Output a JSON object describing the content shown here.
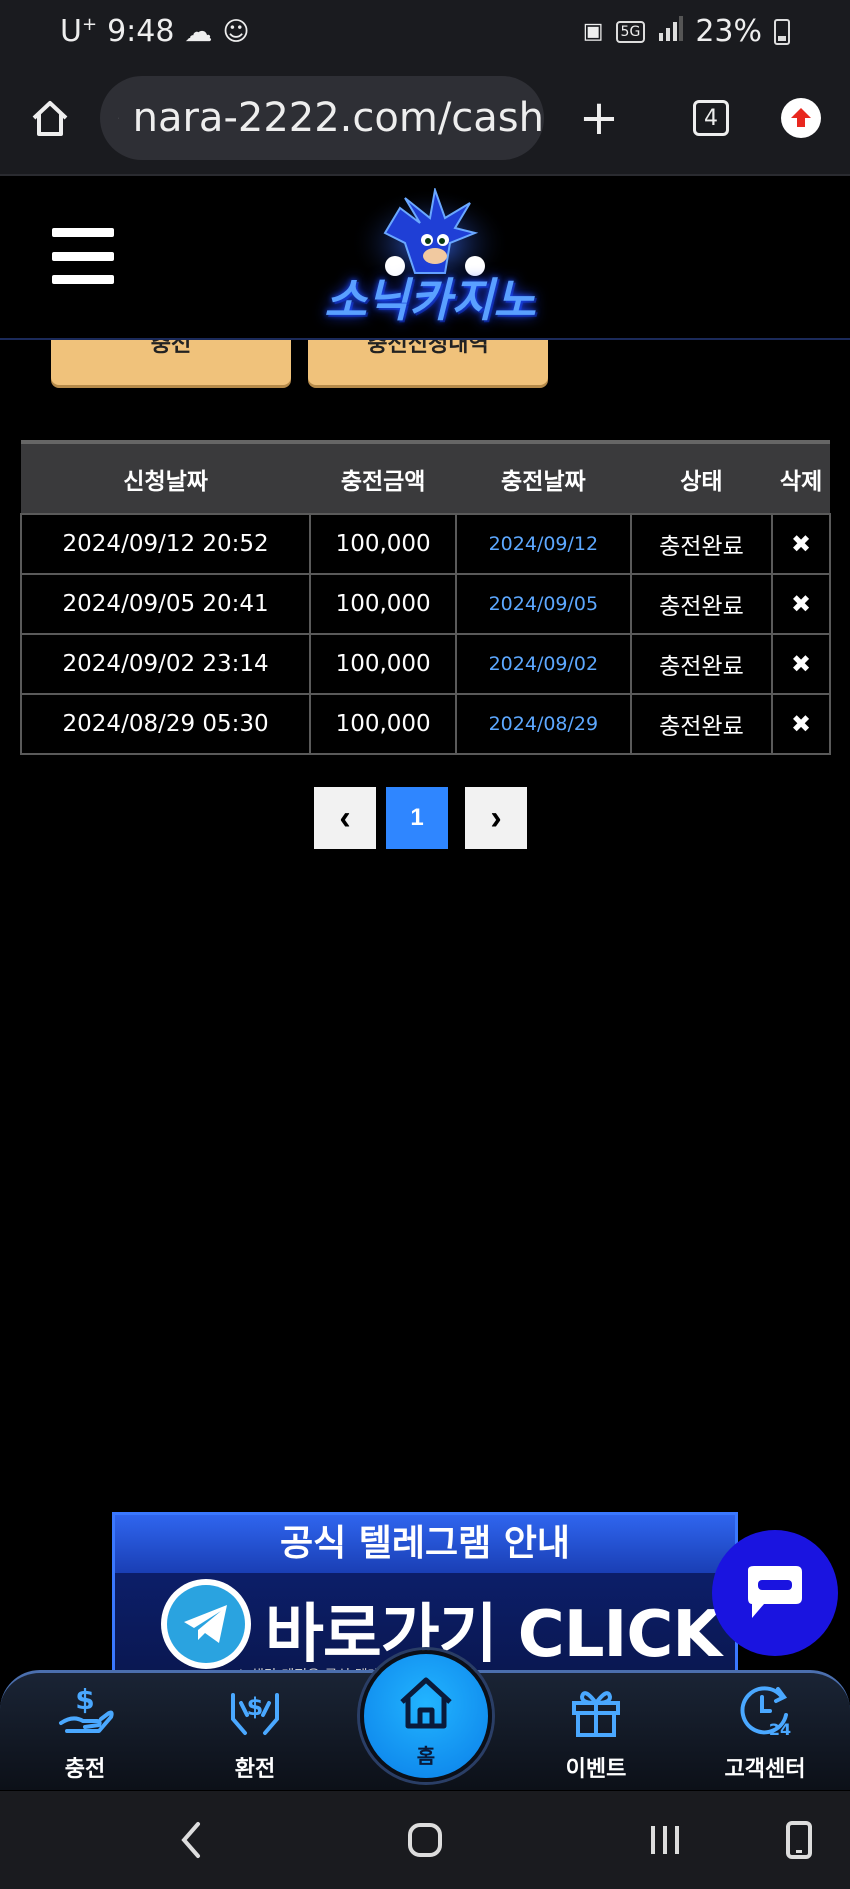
{
  "status_bar": {
    "carrier": "U",
    "carrier_sup": "+",
    "time": "9:48",
    "network_badge": "5G",
    "battery": "23%"
  },
  "browser": {
    "url": "nara-2222.com/cash",
    "tab_count": "4"
  },
  "site": {
    "logo_text": "소닉카지노"
  },
  "top_tabs": [
    {
      "label": "충전"
    },
    {
      "label": "충전신청내역"
    }
  ],
  "table": {
    "headers": [
      "신청날짜",
      "충전금액",
      "충전날짜",
      "상태",
      "삭제"
    ],
    "rows": [
      {
        "requested": "2024/09/12 20:52",
        "amount": "100,000",
        "charged": "2024/09/12",
        "status": "충전완료",
        "delete": "✖"
      },
      {
        "requested": "2024/09/05 20:41",
        "amount": "100,000",
        "charged": "2024/09/05",
        "status": "충전완료",
        "delete": "✖"
      },
      {
        "requested": "2024/09/02 23:14",
        "amount": "100,000",
        "charged": "2024/09/02",
        "status": "충전완료",
        "delete": "✖"
      },
      {
        "requested": "2024/08/29 05:30",
        "amount": "100,000",
        "charged": "2024/08/29",
        "status": "충전완료",
        "delete": "✖"
      }
    ]
  },
  "pagination": {
    "prev": "‹",
    "current": "1",
    "next": "›"
  },
  "telegram_banner": {
    "title": "공식 텔레그램 안내",
    "cta": "바로가기 CLICK",
    "note": "※ 해당 계정은 공식 텔레그램 계정입니다"
  },
  "bottom_nav": {
    "charge": "충전",
    "exchange": "환전",
    "home": "홈",
    "event": "이벤트",
    "support": "고객센터"
  }
}
